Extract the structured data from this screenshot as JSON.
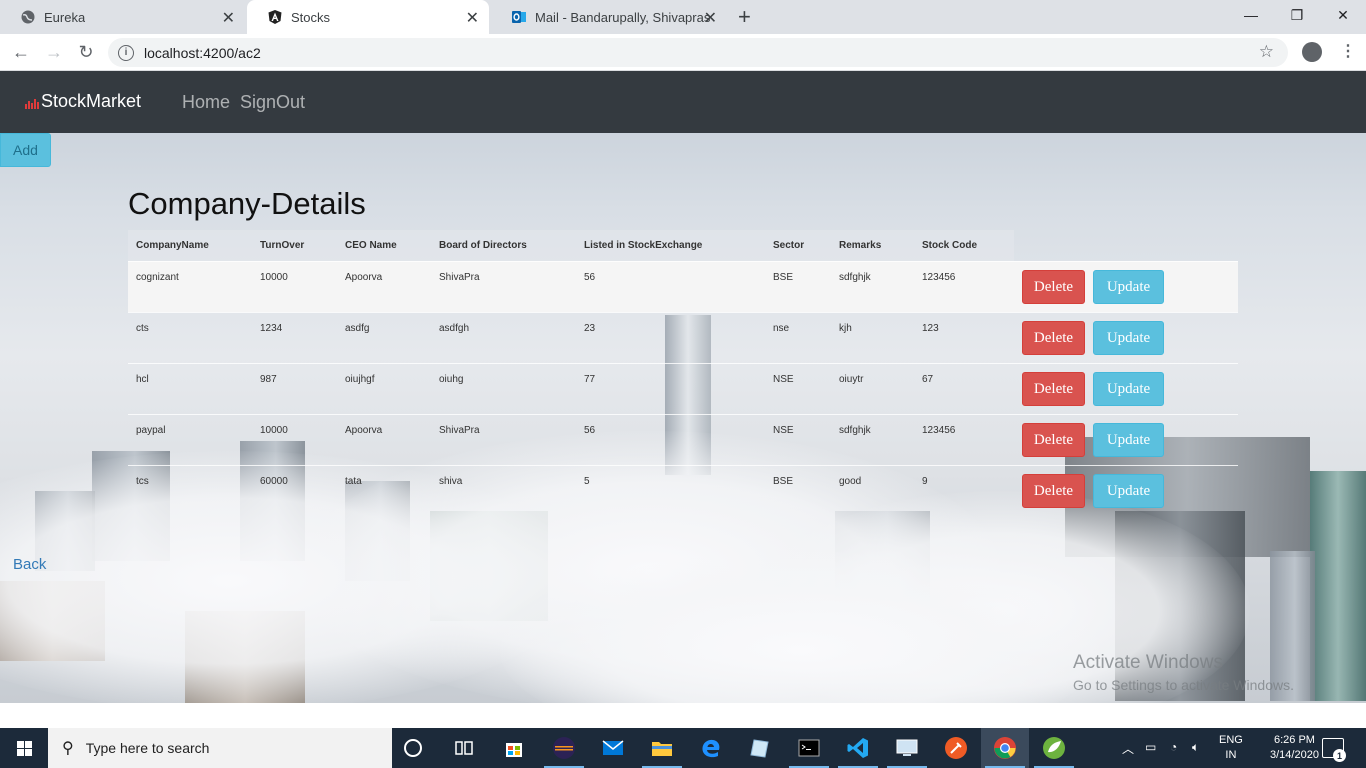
{
  "browser": {
    "tabs": [
      {
        "label": "Eureka",
        "active": false
      },
      {
        "label": "Stocks",
        "active": true
      },
      {
        "label": "Mail - Bandarupally, Shivaprasad",
        "active": false
      }
    ],
    "url": "localhost:4200/ac2"
  },
  "navbar": {
    "brand": "StockMarket",
    "links": [
      "Home",
      "SignOut"
    ]
  },
  "add_button": "Add",
  "page_title": "Company-Details",
  "table": {
    "headers": [
      "CompanyName",
      "TurnOver",
      "CEO Name",
      "Board of Directors",
      "Listed in StockExchange",
      "Sector",
      "Remarks",
      "Stock Code"
    ],
    "rows": [
      [
        "cognizant",
        "10000",
        "Apoorva",
        "ShivaPra",
        "56",
        "BSE",
        "sdfghjk",
        "123456"
      ],
      [
        "cts",
        "1234",
        "asdfg",
        "asdfgh",
        "23",
        "nse",
        "kjh",
        "123"
      ],
      [
        "hcl",
        "987",
        "oiujhgf",
        "oiuhg",
        "77",
        "NSE",
        "oiuytr",
        "67"
      ],
      [
        "paypal",
        "10000",
        "Apoorva",
        "ShivaPra",
        "56",
        "NSE",
        "sdfghjk",
        "123456"
      ],
      [
        "tcs",
        "60000",
        "tata",
        "shiva",
        "5",
        "BSE",
        "good",
        "9"
      ]
    ],
    "delete_label": "Delete",
    "update_label": "Update"
  },
  "back_link": "Back",
  "watermark": {
    "line1": "Activate Windows",
    "line2": "Go to Settings to activate Windows."
  },
  "taskbar": {
    "search_placeholder": "Type here to search",
    "language": "ENG",
    "region": "IN",
    "time": "6:26 PM",
    "date": "3/14/2020",
    "notification_count": "1"
  },
  "colors": {
    "navbar": "#343a40",
    "danger": "#d9534f",
    "info": "#5bc0de",
    "link": "#337ab7",
    "taskbar": "#1c2a3a"
  }
}
